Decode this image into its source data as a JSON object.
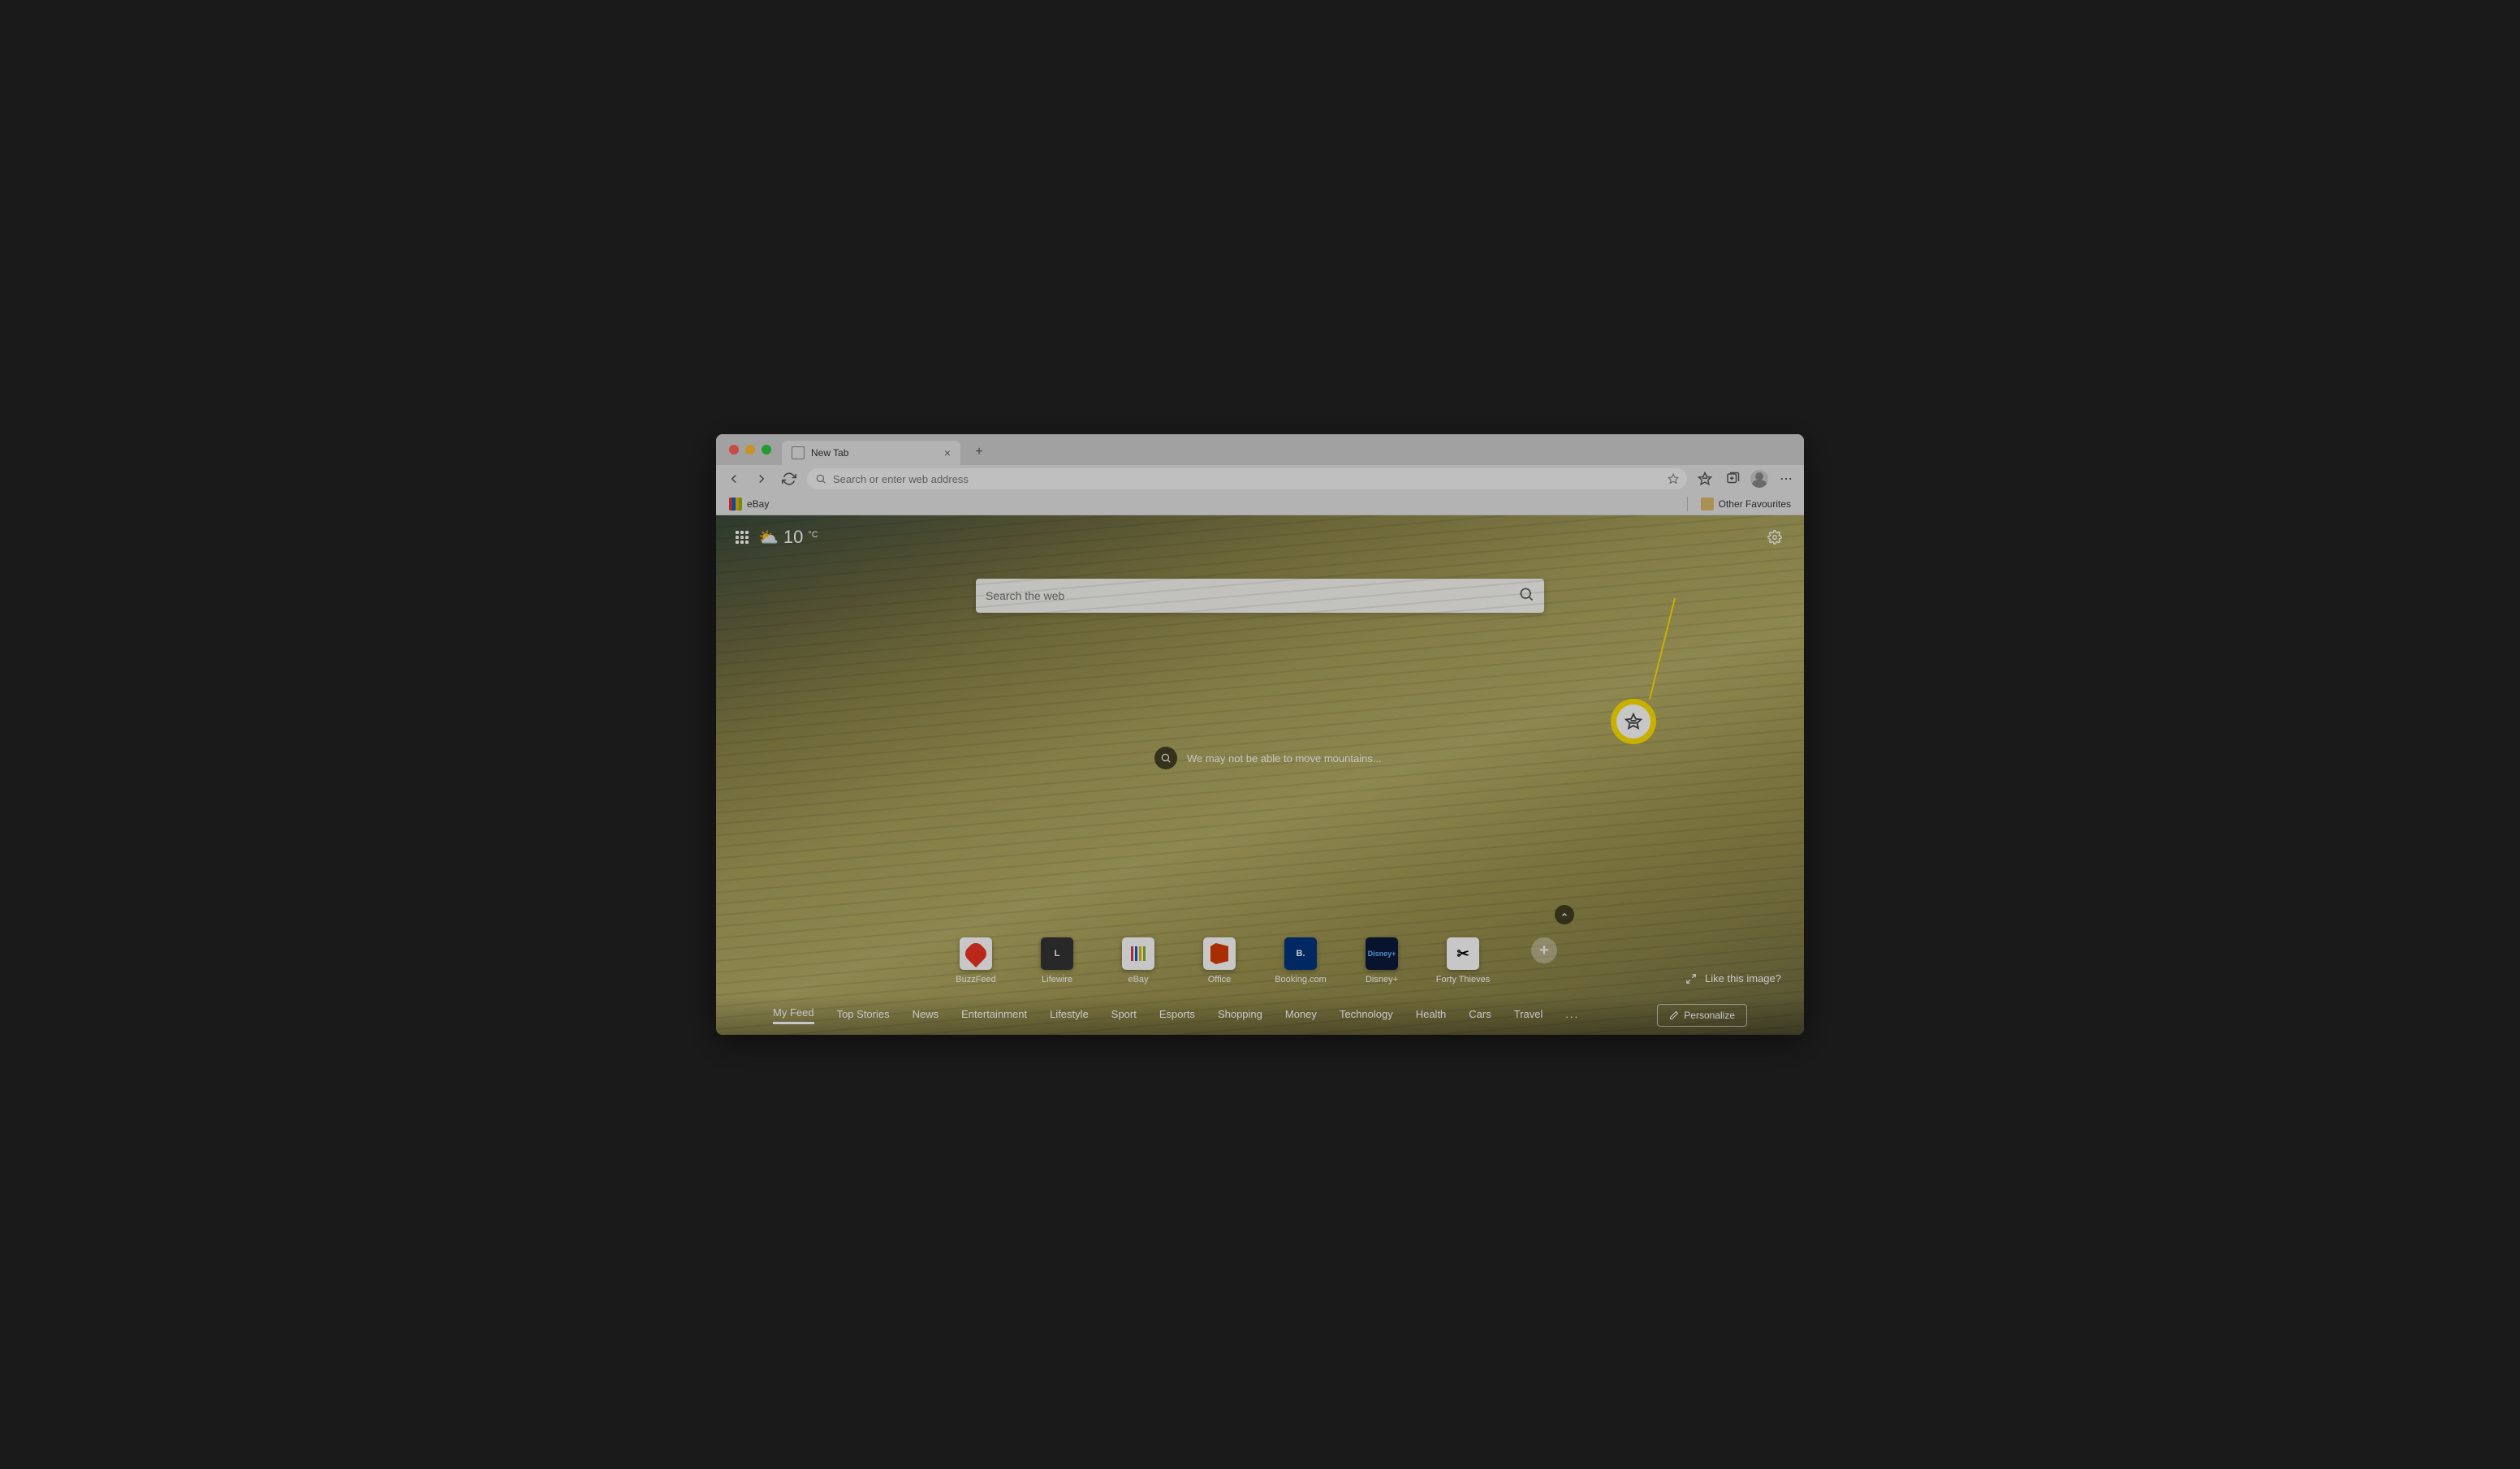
{
  "tab": {
    "title": "New Tab"
  },
  "toolbar": {
    "placeholder": "Search or enter web address"
  },
  "bookmarks": {
    "ebay": "eBay",
    "other_favourites": "Other Favourites"
  },
  "weather": {
    "temp": "10",
    "unit": "°C"
  },
  "search": {
    "placeholder": "Search the web"
  },
  "quote": {
    "text": "We may not be able to move mountains..."
  },
  "quicklinks": [
    {
      "label": "BuzzFeed"
    },
    {
      "label": "Lifewire"
    },
    {
      "label": "eBay"
    },
    {
      "label": "Office"
    },
    {
      "label": "Booking.com"
    },
    {
      "label": "Disney+"
    },
    {
      "label": "Forty Thieves"
    }
  ],
  "like_image": "Like this image?",
  "feed": {
    "items": [
      "My Feed",
      "Top Stories",
      "News",
      "Entertainment",
      "Lifestyle",
      "Sport",
      "Esports",
      "Shopping",
      "Money",
      "Technology",
      "Health",
      "Cars",
      "Travel"
    ],
    "more": "...",
    "personalize": "Personalize"
  }
}
